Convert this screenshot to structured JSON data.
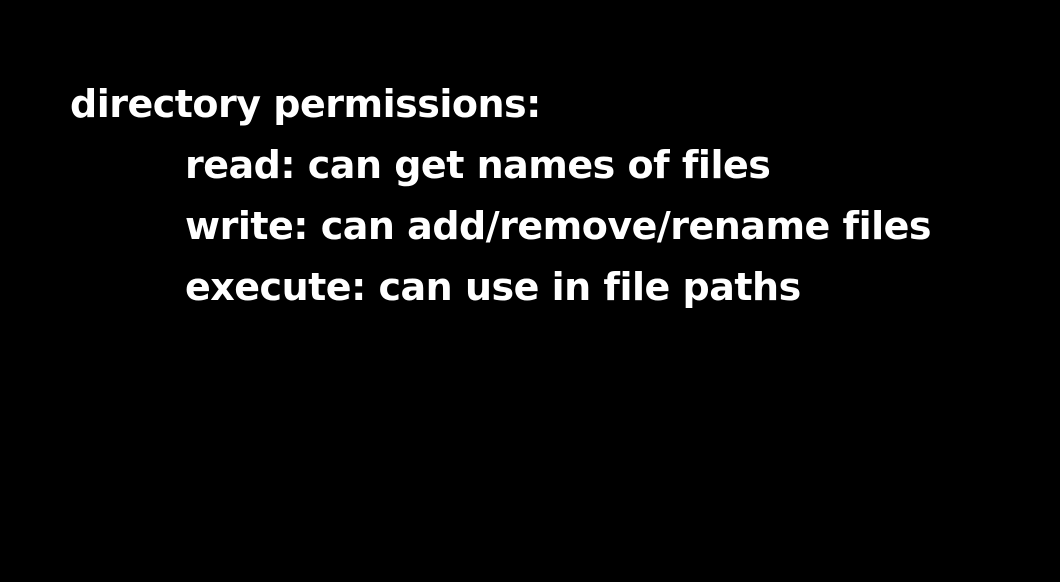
{
  "slide": {
    "heading": "directory permissions:",
    "items": [
      {
        "text": "read: can get names of files"
      },
      {
        "text": "write: can add/remove/rename files"
      },
      {
        "text": "execute: can use in file paths"
      }
    ],
    "colors": {
      "background": "#000000",
      "text": "#ffffff"
    }
  }
}
